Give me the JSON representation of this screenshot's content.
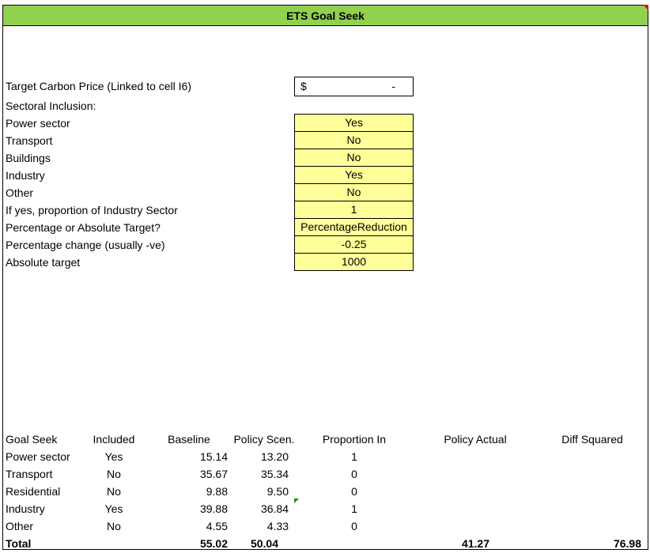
{
  "title": "ETS Goal Seek",
  "inputs": {
    "target_price_label": "Target Carbon Price (Linked to cell I6)",
    "target_price_currency": "$",
    "target_price_value": "-",
    "sectoral_inclusion_label": "Sectoral Inclusion:",
    "rows": [
      {
        "label": "Power sector",
        "value": "Yes"
      },
      {
        "label": "Transport",
        "value": "No"
      },
      {
        "label": "Buildings",
        "value": "No"
      },
      {
        "label": "Industry",
        "value": "Yes"
      },
      {
        "label": "Other",
        "value": "No"
      },
      {
        "label": "If yes, proportion of Industry Sector",
        "value": "1"
      },
      {
        "label": "Percentage or Absolute Target?",
        "value": "PercentageReduction"
      },
      {
        "label": "Percentage change (usually -ve)",
        "value": "-0.25"
      },
      {
        "label": "Absolute target",
        "value": "1000"
      }
    ]
  },
  "table": {
    "headers": [
      "Goal Seek",
      "Included",
      "Baseline",
      "Policy Scen.",
      "Proportion In",
      "Policy Actual",
      "Diff Squared"
    ],
    "rows": [
      [
        "Power sector",
        "Yes",
        "15.14",
        "13.20",
        "1"
      ],
      [
        "Transport",
        "No",
        "35.67",
        "35.34",
        "0"
      ],
      [
        "Residential",
        "No",
        "9.88",
        "9.50",
        "0"
      ],
      [
        "Industry",
        "Yes",
        "39.88",
        "36.84",
        "1"
      ],
      [
        "Other",
        "No",
        "4.55",
        "4.33",
        "0"
      ]
    ],
    "total": {
      "label": "Total",
      "baseline": "55.02",
      "policy": "50.04",
      "actual": "41.27",
      "diff": "76.98"
    }
  }
}
